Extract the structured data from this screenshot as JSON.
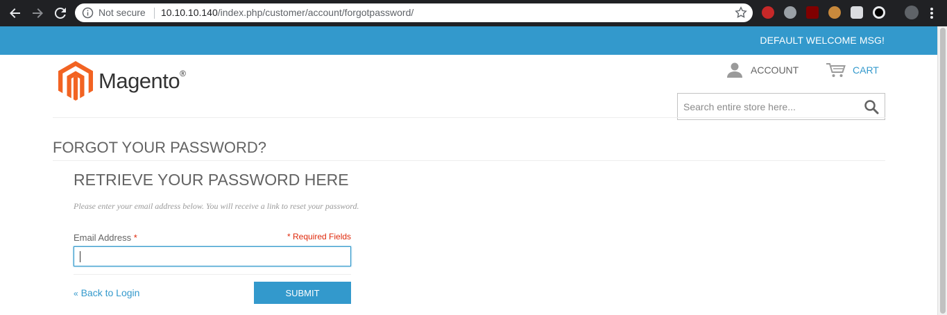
{
  "browser": {
    "security_label": "Not secure",
    "url_host": "10.10.10.140",
    "url_path": "/index.php/customer/account/forgotpassword/"
  },
  "header": {
    "welcome_message": "DEFAULT WELCOME MSG!",
    "logo_text": "Magento",
    "logo_mark": "®",
    "account_label": "ACCOUNT",
    "cart_label": "CART",
    "search_placeholder": "Search entire store here..."
  },
  "page": {
    "title": "FORGOT YOUR PASSWORD?",
    "form_heading": "RETRIEVE YOUR PASSWORD HERE",
    "description": "Please enter your email address below. You will receive a link to reset your password.",
    "email_label": "Email Address",
    "required_star": "*",
    "required_note": "* Required Fields",
    "email_value": "",
    "back_label": "Back to Login",
    "back_prefix": "«",
    "submit_label": "SUBMIT"
  },
  "colors": {
    "accent": "#3399cc",
    "logo_orange": "#f26322",
    "required": "#df280a"
  },
  "icons": [
    "back-arrow-icon",
    "forward-arrow-icon",
    "reload-icon",
    "info-icon",
    "star-icon",
    "account-icon",
    "cart-icon",
    "search-icon",
    "magento-logo-icon"
  ]
}
